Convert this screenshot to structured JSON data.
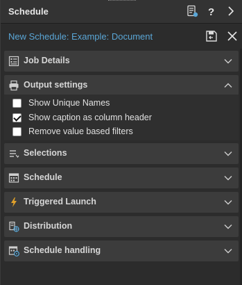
{
  "header": {
    "title": "Schedule"
  },
  "schedule": {
    "name": "New Schedule: Example: Document"
  },
  "sections": {
    "job_details": "Job Details",
    "output_settings": "Output settings",
    "selections": "Selections",
    "schedule": "Schedule",
    "triggered_launch": "Triggered Launch",
    "distribution": "Distribution",
    "schedule_handling": "Schedule handling"
  },
  "output_options": [
    {
      "label": "Show Unique Names",
      "checked": false
    },
    {
      "label": "Show caption as column header",
      "checked": true
    },
    {
      "label": "Remove value based filters",
      "checked": false
    }
  ],
  "colors": {
    "accent": "#5aa6d6",
    "section_bg": "#3c3c3c",
    "panel_bg": "#2c2c2c",
    "bolt": "#e0a12a"
  }
}
